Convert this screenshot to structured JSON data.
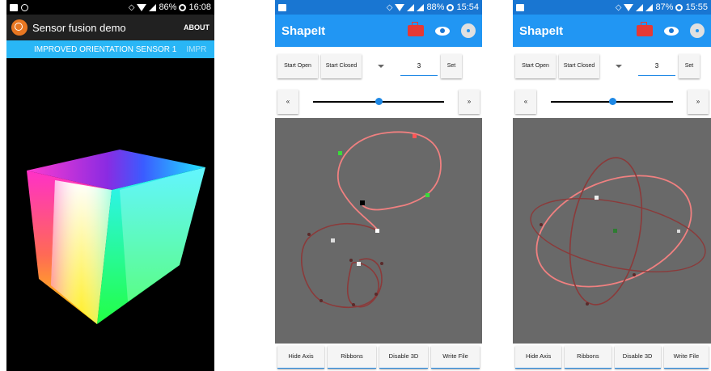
{
  "phone1": {
    "status": {
      "battery": "86%",
      "time": "16:08"
    },
    "title": "Sensor fusion demo",
    "about": "ABOUT",
    "tabs": [
      "IMPROVED ORIENTATION SENSOR 1",
      "IMPR"
    ]
  },
  "phone2": {
    "status": {
      "battery": "88%",
      "time": "15:54"
    },
    "title": "ShapeIt",
    "start_open": "Start Open",
    "start_closed": "Start Closed",
    "number_value": "3",
    "set_label": "Set",
    "prev_label": "«",
    "next_label": "»",
    "slider_value": 0.5,
    "bottom": [
      "Hide Axis",
      "Ribbons",
      "Disable 3D",
      "Write File"
    ]
  },
  "phone3": {
    "status": {
      "battery": "87%",
      "time": "15:55"
    },
    "title": "ShapeIt",
    "start_open": "Start Open",
    "start_closed": "Start Closed",
    "number_value": "3",
    "set_label": "Set",
    "prev_label": "«",
    "next_label": "»",
    "slider_value": 0.5,
    "bottom": [
      "Hide Axis",
      "Ribbons",
      "Disable 3D",
      "Write File"
    ]
  },
  "colors": {
    "statusbar": "#1976d2",
    "toolbar": "#2196f3",
    "tabbar": "#29b6f6",
    "canvas": "#696969",
    "curve_light": "#f08080",
    "curve_dark": "#8b3a3a"
  }
}
